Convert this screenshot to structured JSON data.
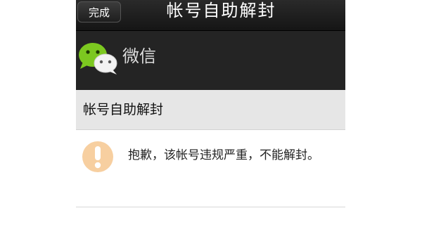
{
  "topbar": {
    "done_label": "完成",
    "title": "帐号自助解封"
  },
  "brand": {
    "logo_icon": "wechat-logo-icon",
    "name": "微信"
  },
  "section": {
    "title": "帐号自助解封"
  },
  "message": {
    "icon": "warning-icon",
    "text": "抱歉，该帐号违规严重，不能解封。"
  },
  "colors": {
    "topbar": "#1e1e1e",
    "brand_bar": "#242424",
    "section_header": "#e6e6e6",
    "logo_green": "#7cc820",
    "warning_orange": "#f7cfa0"
  }
}
